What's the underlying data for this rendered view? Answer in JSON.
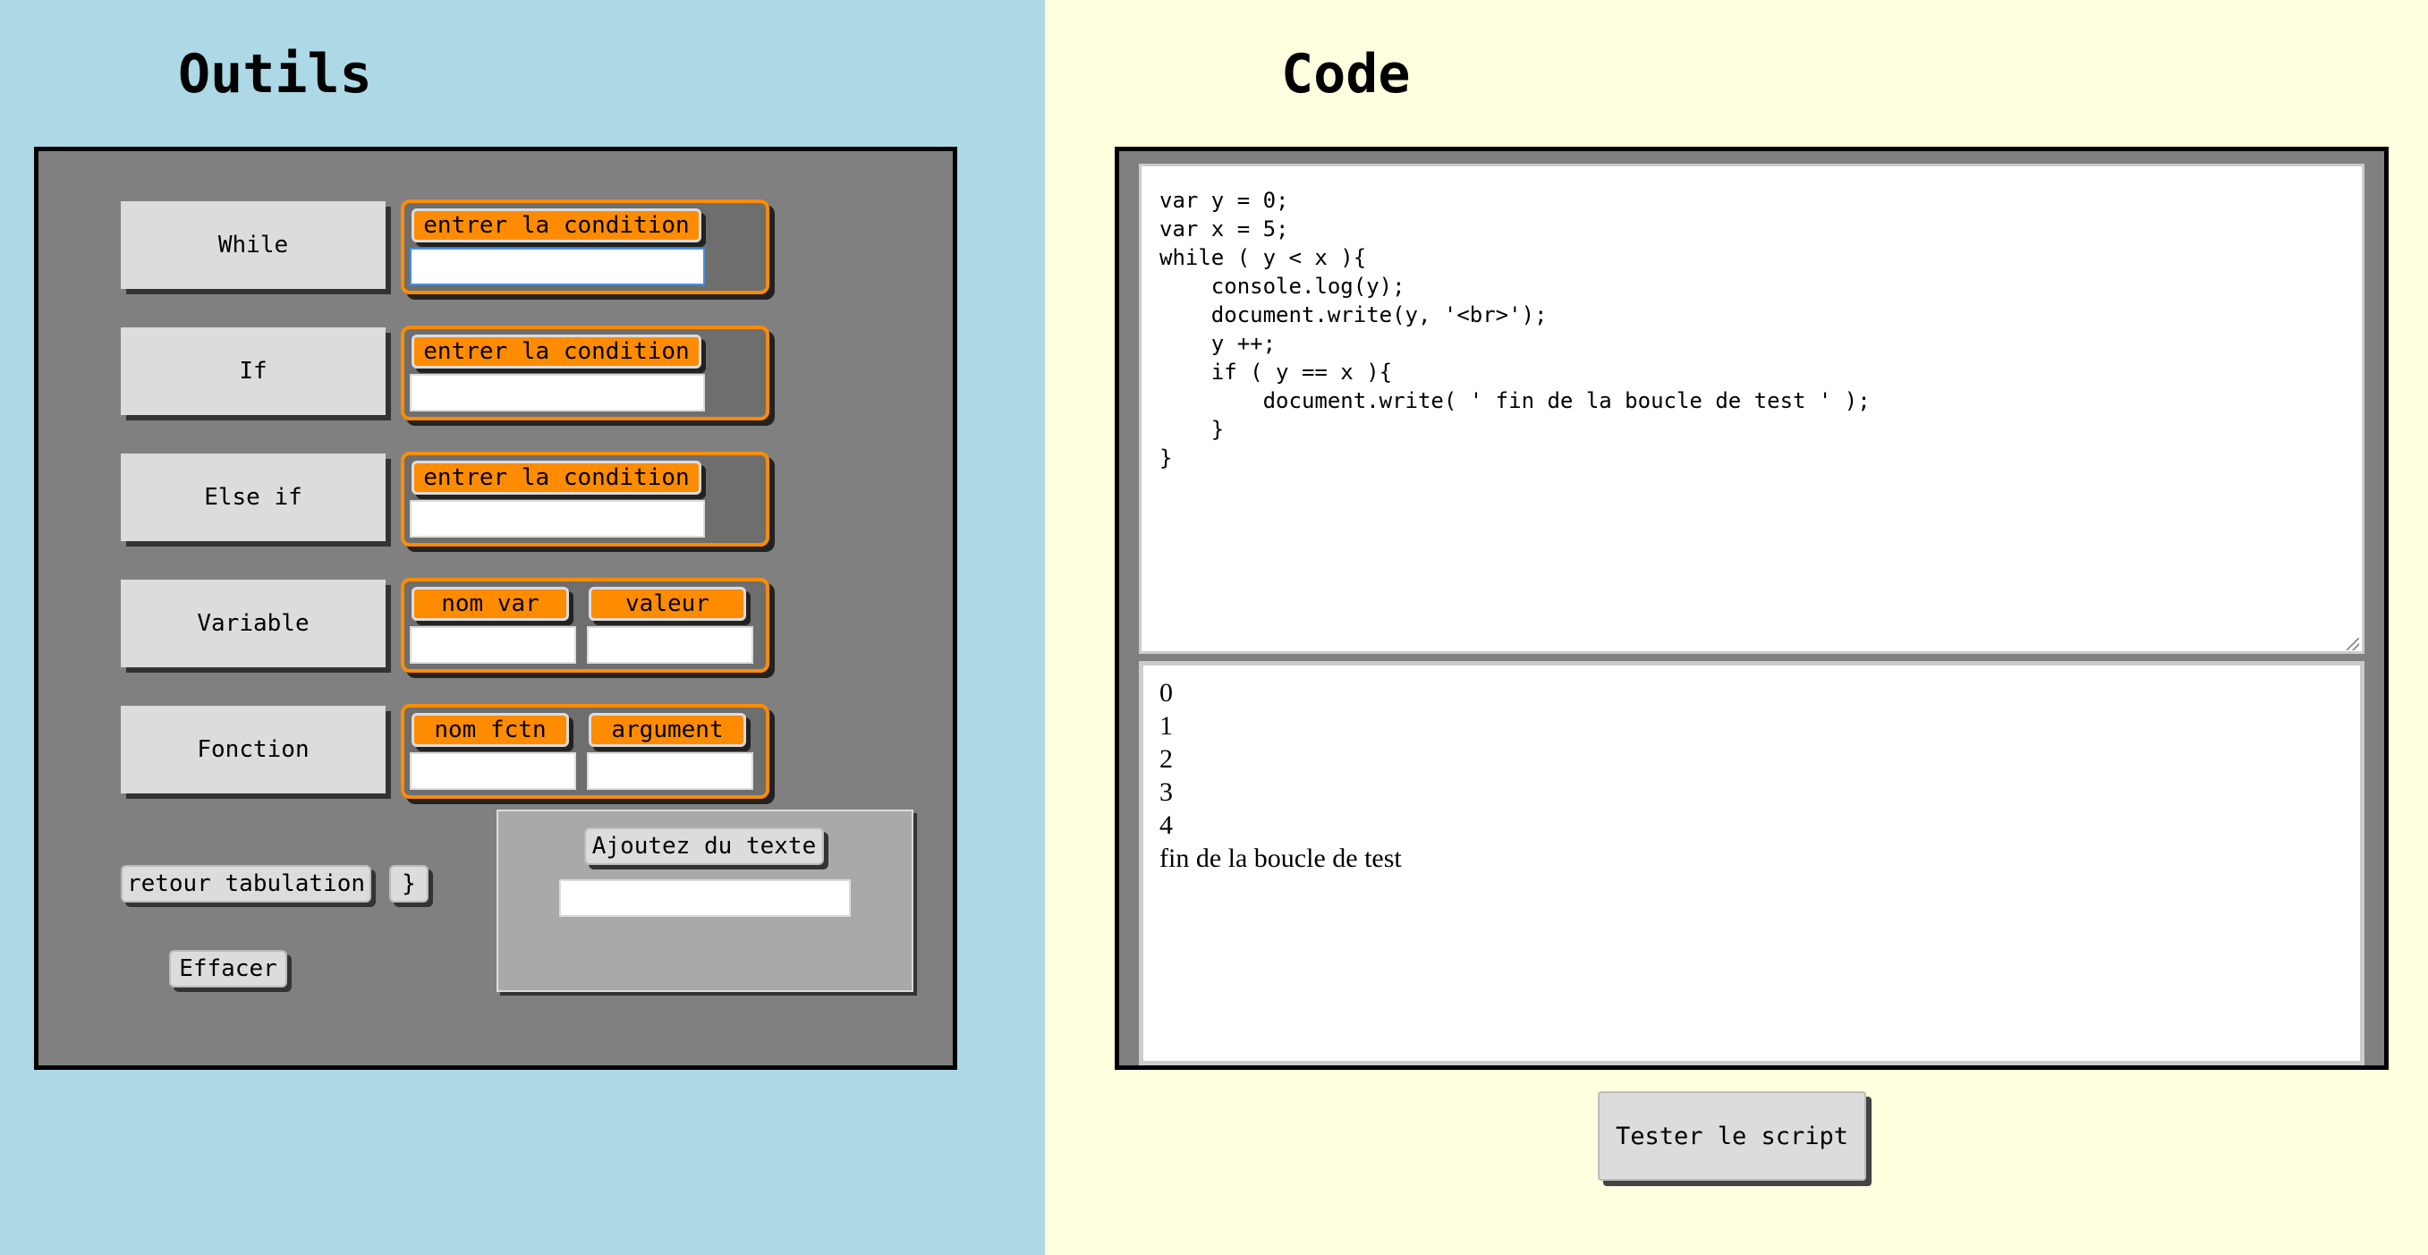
{
  "tools": {
    "title": "Outils",
    "while_label": "While",
    "if_label": "If",
    "elseif_label": "Else if",
    "variable_label": "Variable",
    "function_label": "Fonction",
    "condition_label": "entrer la condition",
    "var_name_label": "nom var",
    "var_value_label": "valeur",
    "func_name_label": "nom fctn",
    "func_arg_label": "argument",
    "retour_tab_label": "retour tabulation",
    "close_brace_label": "}",
    "effacer_label": "Effacer",
    "add_text_label": "Ajoutez du texte"
  },
  "code": {
    "title": "Code",
    "script": "var y = 0;\nvar x = 5;\nwhile ( y < x ){\n    console.log(y);\n    document.write(y, '<br>');\n    y ++;\n    if ( y == x ){\n        document.write( ' fin de la boucle de test ' );\n    }\n}",
    "output": [
      "0",
      "1",
      "2",
      "3",
      "4",
      "fin de la boucle de test"
    ],
    "test_label": "Tester le script"
  },
  "colors": {
    "left_bg": "#add8e6",
    "right_bg": "#ffffe0",
    "panel_gray": "#808080",
    "accent_orange": "#ff8c00"
  }
}
